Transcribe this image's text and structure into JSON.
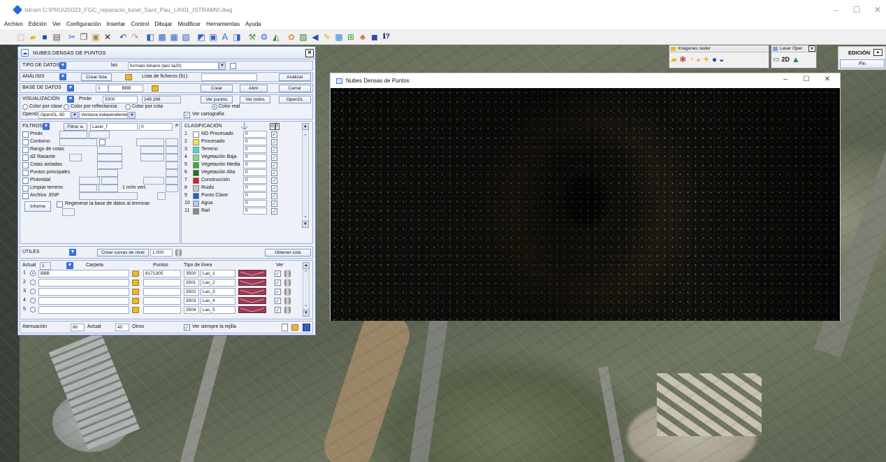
{
  "window": {
    "title": "Istram  C:\\PRU\\25023_FGC_reparacio_tunel_Sant_Pau_LA\\01_ISTRAM\\0.dwg",
    "minimize": "–",
    "maximize": "☐",
    "close": "✕"
  },
  "menu": [
    "Archivo",
    "Edición",
    "Ver",
    "Configuración",
    "Insertar",
    "Control",
    "Dibujar",
    "Modificar",
    "Herramientas",
    "Ayuda"
  ],
  "toolbar_icons": [
    "new-icon",
    "open-icon",
    "save-icon",
    "print-icon",
    "cut-icon",
    "copy-icon",
    "paste-icon",
    "delete-icon",
    "undo-icon",
    "redo-icon",
    "layer-icon",
    "layer2-icon",
    "layer3-icon",
    "layer4-icon",
    "view-icon",
    "view2-icon",
    "text-icon",
    "view3-icon",
    "tool-icon",
    "tool2-icon",
    "tool3-icon",
    "palette-icon",
    "image-icon",
    "arrow-icon",
    "pencil-icon",
    "photo-icon",
    "grid-icon",
    "tree-icon",
    "book-icon",
    "help-icon"
  ],
  "dialog": {
    "title": "NUBES DENSAS DE PUNTOS",
    "tipo": {
      "label": "TIPO DE DATOS",
      "ext": "las",
      "format": "formato binario (las/ la20)"
    },
    "analisis": {
      "label": "ANÁLISIS",
      "crear_lista": "Crear lista",
      "lista": "Lista de ficheros (lt1):",
      "analizar": "Analizar"
    },
    "base": {
      "label": "BASE DE DATOS",
      "num": "1",
      "name": "BBB",
      "crear": "Crear",
      "abrir": "Abrir",
      "cerrar": "Cerrar"
    },
    "vis": {
      "label": "VISUALIZACIÓN",
      "pmax_label": "Pmáx",
      "pmax": "5000",
      "count": "149.166",
      "ver_puntos": "Ver puntos",
      "ver_todos": "Ver todos",
      "opengl": "OpenGL",
      "r1": "Color por clase",
      "r2": "Color por reflectancia",
      "r3": "Color por cota",
      "r4": "Color real",
      "gl_label": "OpenGL:",
      "gl_mode": "OpenGL 3D",
      "window_mode": "Ventana independiente",
      "cartografia": "Ver cartografía"
    },
    "filtros": {
      "label": "FILTROS",
      "filtrar": "Filtrar a:",
      "target": "Laser_f",
      "value": "0",
      "p": "P",
      "items": [
        "Pmáx",
        "Contorno",
        "Rango de cotas",
        "dZ Rasante",
        "Cotas aisladas",
        "Puntos principales",
        "Pirámidal",
        "Limpiar terreno",
        "Archivo .ENP"
      ],
      "mm": "1 m/m vert.",
      "informe": "Informe",
      "regenerar": "Regenerar la base de datos al terminar"
    },
    "clasif": {
      "label": "CLASIFICACIÓN",
      "col_o": "o",
      "col_i": "l",
      "rows": [
        {
          "n": "1",
          "name": "NO Procesado",
          "v": "0",
          "color": "#ffffff"
        },
        {
          "n": "2",
          "name": "Procesado",
          "v": "0",
          "color": "#f5e64a"
        },
        {
          "n": "3",
          "name": "Terreno",
          "v": "0",
          "color": "#46d9d9"
        },
        {
          "n": "4",
          "name": "Vegetación Baja",
          "v": "0",
          "color": "#7fe07f"
        },
        {
          "n": "5",
          "name": "Vegetación Media",
          "v": "0",
          "color": "#2fb02f"
        },
        {
          "n": "6",
          "name": "Vegetación Alta",
          "v": "0",
          "color": "#1c7a1c"
        },
        {
          "n": "7",
          "name": "Construcción",
          "v": "0",
          "color": "#e01a1a"
        },
        {
          "n": "8",
          "name": "Ruido",
          "v": "0",
          "color": "#c8c8c8"
        },
        {
          "n": "9",
          "name": "Punto Clave",
          "v": "0",
          "color": "#1f5fe0"
        },
        {
          "n": "10",
          "name": "Agua",
          "v": "0",
          "color": "#9fd0f5"
        },
        {
          "n": "11",
          "name": "Rail",
          "v": "0",
          "color": "#8a8a8a"
        }
      ]
    },
    "utiles": {
      "label": "ÚTILES",
      "curvas": "Crear curvas de nivel",
      "curvas_val": "1.000",
      "obtener": "Obtener cota"
    },
    "files": {
      "actual_label": "Actual",
      "actual": "1",
      "carpeta": "Carpeta",
      "puntos": "Puntos",
      "tipo": "Tipo de línea",
      "ver": "Ver",
      "rows": [
        {
          "n": "1",
          "folder": "BBB",
          "points": "6171305",
          "code": "3500",
          "line": "Las_1"
        },
        {
          "n": "2",
          "folder": "",
          "points": "",
          "code": "3501",
          "line": "Las_2"
        },
        {
          "n": "3",
          "folder": "",
          "points": "",
          "code": "3502",
          "line": "Las_3"
        },
        {
          "n": "4",
          "folder": "",
          "points": "",
          "code": "3503",
          "line": "Las_4"
        },
        {
          "n": "5",
          "folder": "",
          "points": "",
          "code": "3504",
          "line": "Las_5"
        }
      ]
    },
    "footer": {
      "aten": "Atenuación",
      "aten_val": "80",
      "actual": "Actual",
      "actual_val": "40",
      "otros": "Otros",
      "rejilla": "Ver siempre la rejilla"
    }
  },
  "pcwindow": {
    "title": "Nubes Densas de Puntos",
    "min": "–",
    "max": "☐",
    "close": "✕"
  },
  "raster": {
    "title": "Imágenes raster"
  },
  "laser": {
    "title": "Laser Oper",
    "mode": "2D"
  },
  "edicion": {
    "title": "EDICIÓN",
    "fin": "Fin"
  }
}
